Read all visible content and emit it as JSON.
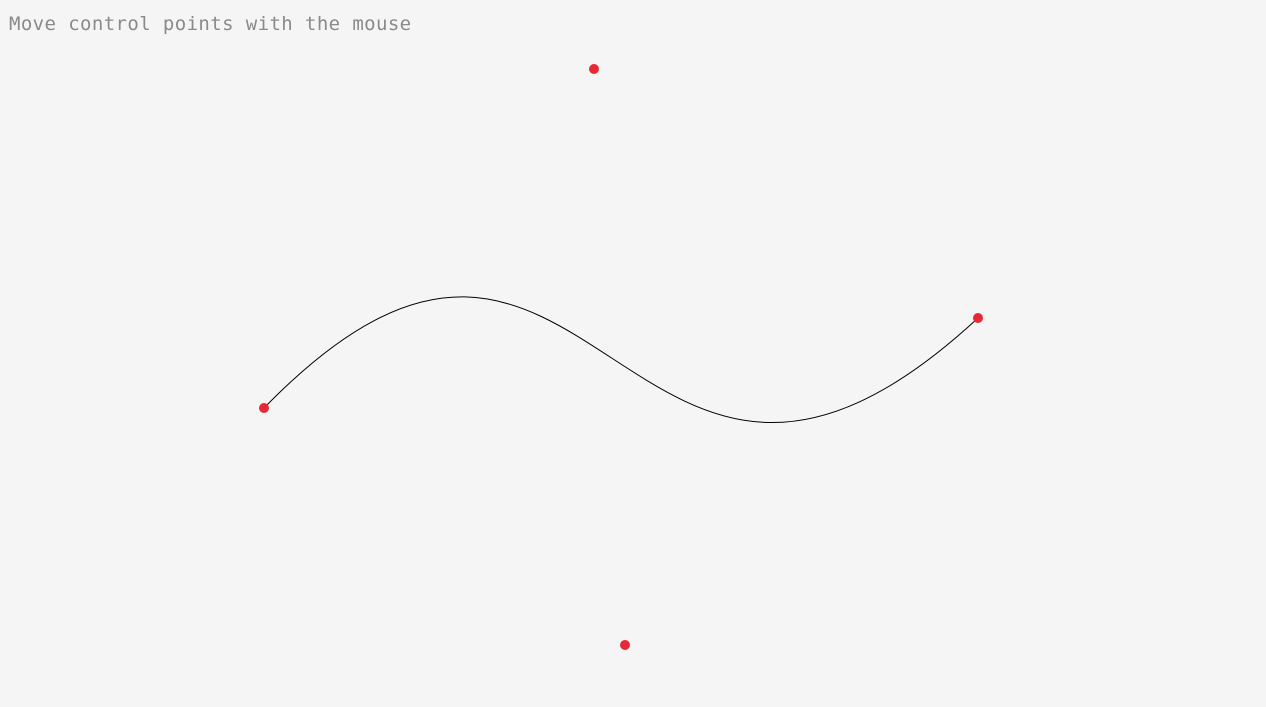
{
  "instructions": "Move control points with the mouse",
  "colors": {
    "background": "#f5f5f5",
    "curve": "#000000",
    "control_point": "#e62937",
    "text": "#8a8a8a"
  },
  "curve": {
    "type": "cubic-bezier",
    "start": [
      264,
      408
    ],
    "control1": [
      594,
      69
    ],
    "control2": [
      625,
      645
    ],
    "end": [
      978,
      318
    ]
  }
}
